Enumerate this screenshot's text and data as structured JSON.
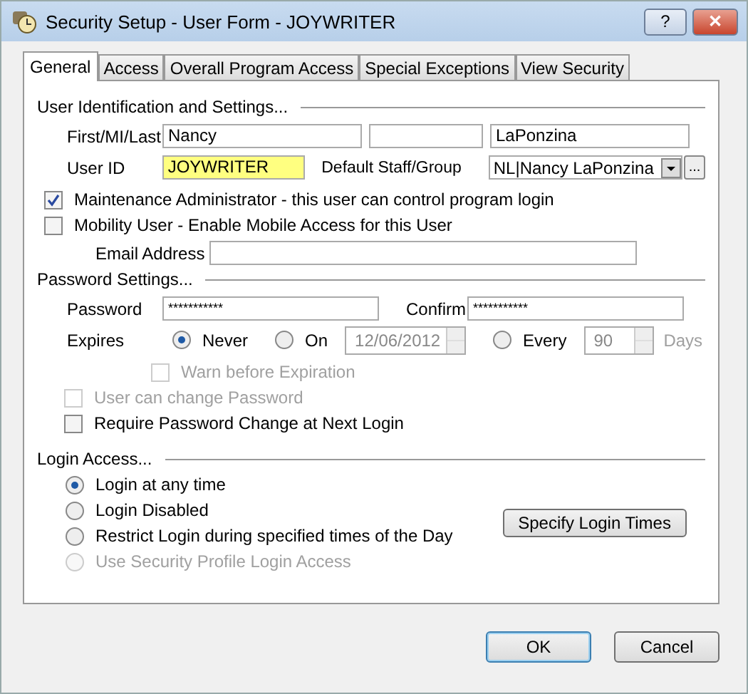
{
  "window": {
    "title": "Security Setup - User Form - JOYWRITER",
    "help_button": "?",
    "close_button": "✕"
  },
  "tabs": [
    {
      "label": "General",
      "selected": true
    },
    {
      "label": "Access",
      "selected": false
    },
    {
      "label": "Overall Program Access",
      "selected": false
    },
    {
      "label": "Special Exceptions",
      "selected": false
    },
    {
      "label": "View Security",
      "selected": false
    }
  ],
  "user_section": {
    "heading": "User Identification and Settings...",
    "name_label": "First/MI/Last",
    "first": "Nancy",
    "last": "LaPonzina",
    "user_id_label": "User ID",
    "user_id": "JOYWRITER",
    "staff_label": "Default Staff/Group",
    "staff_value": "NL|Nancy LaPonzina",
    "browse_button": "...",
    "checkboxes": [
      {
        "label": "Maintenance Administrator - this user can control program login",
        "checked": true,
        "disabled": false
      },
      {
        "label": "Mobility User - Enable Mobile Access for this User",
        "checked": false,
        "disabled": false
      }
    ],
    "email_label": "Email Address"
  },
  "password_section": {
    "heading": "Password Settings...",
    "password_label": "Password",
    "password": "***********",
    "confirm_label": "Confirm",
    "confirm": "***********",
    "expires_label": "Expires",
    "expiry_options": [
      {
        "kind": "plain",
        "label": "Never",
        "selected": true
      },
      {
        "kind": "date",
        "label": "On",
        "selected": false,
        "value": "12/06/2012"
      },
      {
        "kind": "interval",
        "label": "Every",
        "selected": false,
        "value": "90",
        "unit": "Days"
      }
    ],
    "warn": {
      "label": "Warn before Expiration",
      "checked": false,
      "disabled": true
    },
    "checkboxes": [
      {
        "label": "User can change Password",
        "checked": false,
        "disabled": true
      },
      {
        "label": "Require Password Change at Next Login",
        "checked": false,
        "disabled": false
      }
    ]
  },
  "login_section": {
    "heading": "Login Access...",
    "options": [
      {
        "label": "Login at any time",
        "selected": true,
        "disabled": false
      },
      {
        "label": "Login Disabled",
        "selected": false,
        "disabled": false
      },
      {
        "label": "Restrict Login during specified times of the Day",
        "selected": false,
        "disabled": false
      },
      {
        "label": "Use Security Profile Login Access",
        "selected": false,
        "disabled": true
      }
    ],
    "button": "Specify Login Times"
  },
  "footer_buttons": [
    {
      "label": "OK",
      "default": true
    },
    {
      "label": "Cancel",
      "default": false
    }
  ]
}
